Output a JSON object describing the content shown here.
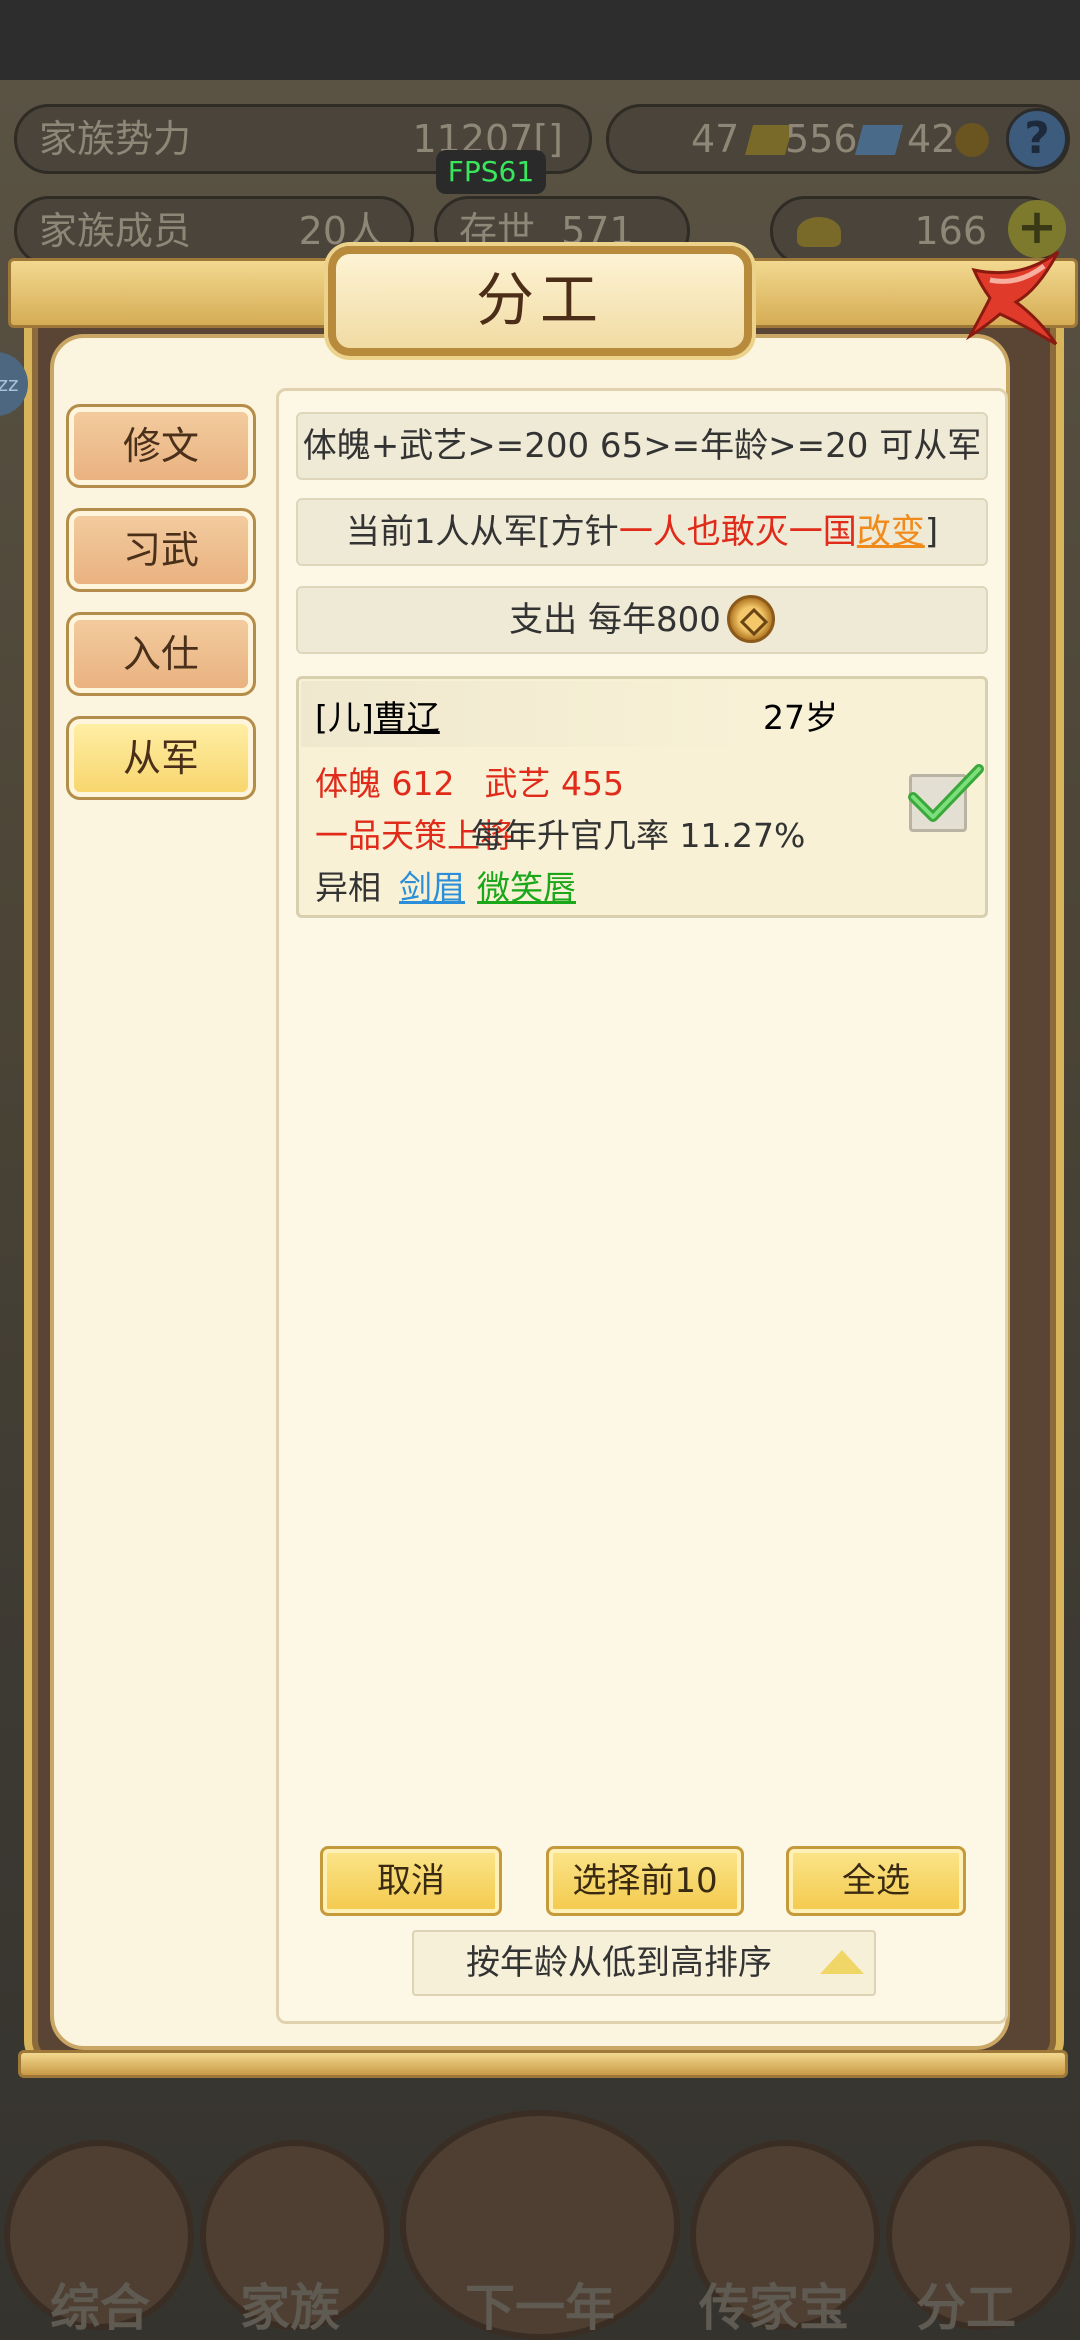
{
  "background": {
    "family_power_label": "家族势力",
    "family_power_value": "11207[",
    "family_power_tag": "",
    "family_power_close": "]",
    "family_members_label": "家族成员",
    "family_members_value": "20人",
    "existence_label": "存世",
    "existence_value": "571年",
    "res_gold": "47",
    "res_silver": "556",
    "res_coin": "42",
    "res_ingot": "166",
    "fps": "FPS61",
    "help": "?",
    "plus": "+",
    "zz": "zz",
    "nav": [
      "综合",
      "家族",
      "下一年",
      "传家宝",
      "分工"
    ]
  },
  "modal": {
    "title": "分工",
    "tabs": [
      {
        "label": "修文",
        "active": false
      },
      {
        "label": "习武",
        "active": false
      },
      {
        "label": "入仕",
        "active": false
      },
      {
        "label": "从军",
        "active": true
      }
    ],
    "requirement": "体魄+武艺>=200 65>=年龄>=20 可从军",
    "policy_prefix": "当前1人从军[方针",
    "policy_value": "一人也敢灭一国",
    "policy_change": "改变",
    "policy_suffix": "]",
    "expense_label": "支出 每年800",
    "member": {
      "relation": "[儿]",
      "name": "曹辽",
      "age": "27岁",
      "stat_body": "体魄 612",
      "stat_martial": "武艺 455",
      "rank": "一品天策上将",
      "promotion": "每年升官几率 11.27%",
      "traits_label": "异相",
      "trait1": "剑眉",
      "trait2": "微笑唇",
      "selected": true
    },
    "buttons": {
      "cancel": "取消",
      "select_top10": "选择前10",
      "select_all": "全选"
    },
    "sort_label": "按年龄从低到高排序"
  }
}
